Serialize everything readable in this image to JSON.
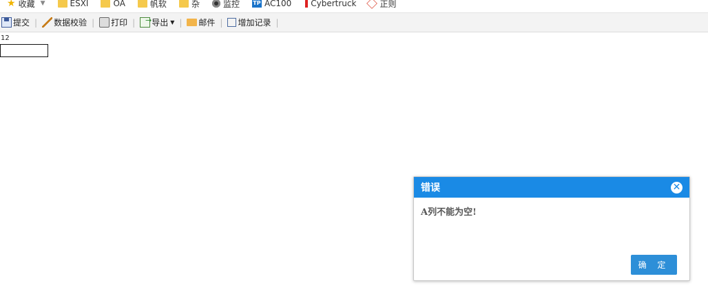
{
  "bookmarks": [
    {
      "icon": "star-icon",
      "label": "收藏"
    },
    {
      "icon": "folder-icon",
      "label": "ESXI"
    },
    {
      "icon": "folder-icon",
      "label": "OA"
    },
    {
      "icon": "folder-icon",
      "label": "帆软"
    },
    {
      "icon": "folder-icon",
      "label": "杂"
    },
    {
      "icon": "camera-icon",
      "label": "监控"
    },
    {
      "icon": "ac-icon",
      "label": "AC100"
    },
    {
      "icon": "pin-icon",
      "label": "Cybertruck"
    },
    {
      "icon": "cube-icon",
      "label": "正则"
    }
  ],
  "toolbar": {
    "submit": "提交",
    "validate": "数据校验",
    "print": "打印",
    "export": "导出",
    "mail": "邮件",
    "add_record": "增加记录"
  },
  "content": {
    "cell_label": "12",
    "cell_value": ""
  },
  "dialog": {
    "title": "错误",
    "message": "A列不能为空!",
    "ok_label": "确 定",
    "header_color": "#1a8ae5",
    "button_color": "#2d8fd8"
  }
}
